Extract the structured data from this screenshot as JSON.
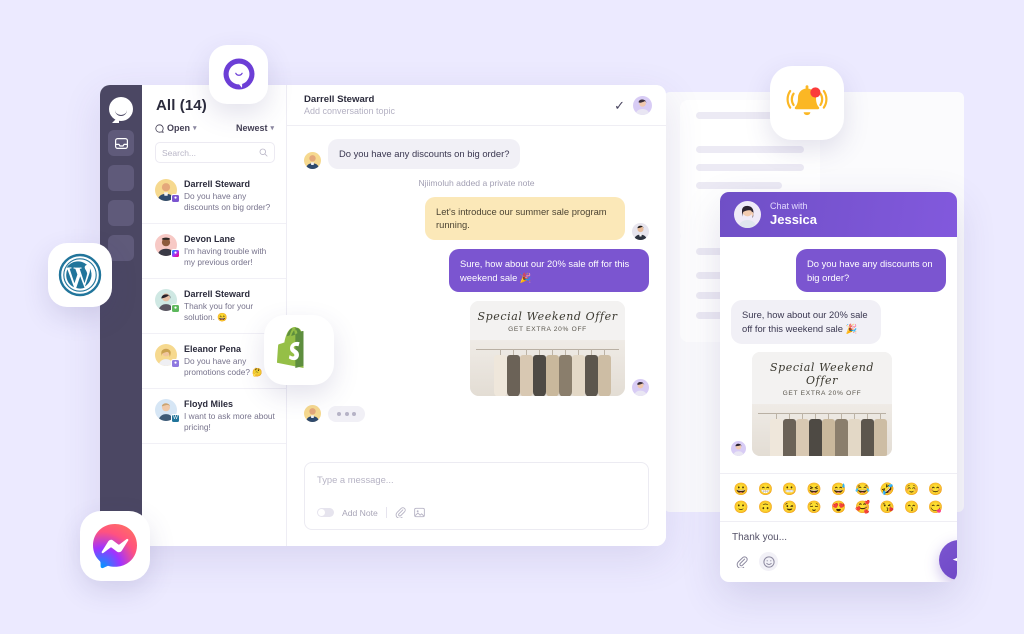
{
  "colors": {
    "page_background": "#eceaff",
    "accent_purple": "#7b55d0",
    "nav_rail": "#4b4763",
    "note_yellow": "#fbe8b8",
    "bubble_grey": "#f1f0f6"
  },
  "nav_rail": {
    "logo_icon": "chat-smile-logo",
    "items": [
      {
        "icon": "inbox-icon",
        "active": true
      },
      {
        "icon": "placeholder-icon"
      },
      {
        "icon": "placeholder-icon"
      },
      {
        "icon": "placeholder-icon"
      }
    ]
  },
  "conversation_list": {
    "title": "All (14)",
    "status_filter": {
      "label": "Open",
      "icon": "chat-circle-icon",
      "chevron": "chevron-down-icon"
    },
    "sort_filter": {
      "label": "Newest",
      "chevron": "chevron-down-icon"
    },
    "search": {
      "placeholder": "Search...",
      "value": "",
      "icon": "search-icon"
    },
    "items": [
      {
        "name": "Darrell Steward",
        "preview": "Do you have any discounts on big order?",
        "channel": "livechat",
        "channel_color": "#7b55d0",
        "avatar_bg": "#f6d98f",
        "selected": true
      },
      {
        "name": "Devon Lane",
        "preview": "I'm having trouble with my previous order!",
        "channel": "messenger",
        "channel_color": "#e0397c",
        "avatar_bg": "#f7c9c5"
      },
      {
        "name": "Darrell Steward",
        "preview": "Thank you for your solution. 😄",
        "channel": "whatsapp",
        "channel_color": "#5cb85c",
        "avatar_bg": "#cfe8e3"
      },
      {
        "name": "Eleanor Pena",
        "preview": "Do you have any promotions code? 🤔",
        "channel": "livechat",
        "channel_color": "#8f78e0",
        "avatar_bg": "#f6d98f"
      },
      {
        "name": "Floyd Miles",
        "preview": "I want to ask more about pricing!",
        "channel": "wordpress",
        "channel_color": "#21759b",
        "avatar_bg": "#d6e6f5"
      }
    ]
  },
  "conversation_header": {
    "name": "Darrell Steward",
    "topic_placeholder": "Add conversation topic",
    "resolve_icon": "check-icon",
    "agent_avatar": "agent-avatar"
  },
  "messages": [
    {
      "type": "incoming",
      "text": "Do you have any discounts on big order?",
      "avatar": "customer-avatar"
    },
    {
      "type": "system",
      "text": "Njiimoluh added a private note"
    },
    {
      "type": "note",
      "text": "Let's introduce our summer sale program running.",
      "avatar": "agent-male-avatar"
    },
    {
      "type": "outgoing",
      "text": "Sure, how about our 20% sale off for this weekend sale 🎉"
    },
    {
      "type": "image",
      "title": "Special Weekend Offer",
      "subtitle": "GET EXTRA 20% OFF",
      "avatar": "agent-avatar"
    },
    {
      "type": "typing",
      "avatar": "customer-avatar",
      "dots": 3
    }
  ],
  "composer": {
    "placeholder": "Type a message...",
    "value": "",
    "note_toggle_label": "Add Note",
    "note_toggle_on": false,
    "attach_icon": "paperclip-icon",
    "image_icon": "image-icon"
  },
  "widget": {
    "header": {
      "eyebrow": "Chat with",
      "name": "Jessica",
      "avatar": "jessica-avatar"
    },
    "messages": [
      {
        "type": "outgoing",
        "text": "Do you have any discounts on big order?"
      },
      {
        "type": "incoming",
        "text": "Sure, how about our 20% sale off for this weekend sale 🎉"
      },
      {
        "type": "image",
        "title": "Special Weekend Offer",
        "subtitle": "GET EXTRA 20% OFF",
        "avatar": "jessica-avatar"
      }
    ],
    "emoji_picker": {
      "row1": [
        "😀",
        "😁",
        "😬",
        "😆",
        "😅",
        "😂",
        "🤣",
        "☺️",
        "😊"
      ],
      "row2": [
        "🙂",
        "🙃",
        "😉",
        "😌",
        "😍",
        "🥰",
        "😘",
        "😙",
        "😋"
      ]
    },
    "input": {
      "value": "Thank you...",
      "attach_icon": "paperclip-icon",
      "emoji_icon": "smiley-icon",
      "send_icon": "send-icon"
    }
  },
  "floating_icons": [
    {
      "name": "livechat-app-icon",
      "label": "LiveChat"
    },
    {
      "name": "wordpress-app-icon",
      "label": "WordPress"
    },
    {
      "name": "shopify-app-icon",
      "label": "Shopify"
    },
    {
      "name": "messenger-app-icon",
      "label": "Messenger"
    },
    {
      "name": "notification-bell-icon",
      "label": "Notifications"
    }
  ]
}
